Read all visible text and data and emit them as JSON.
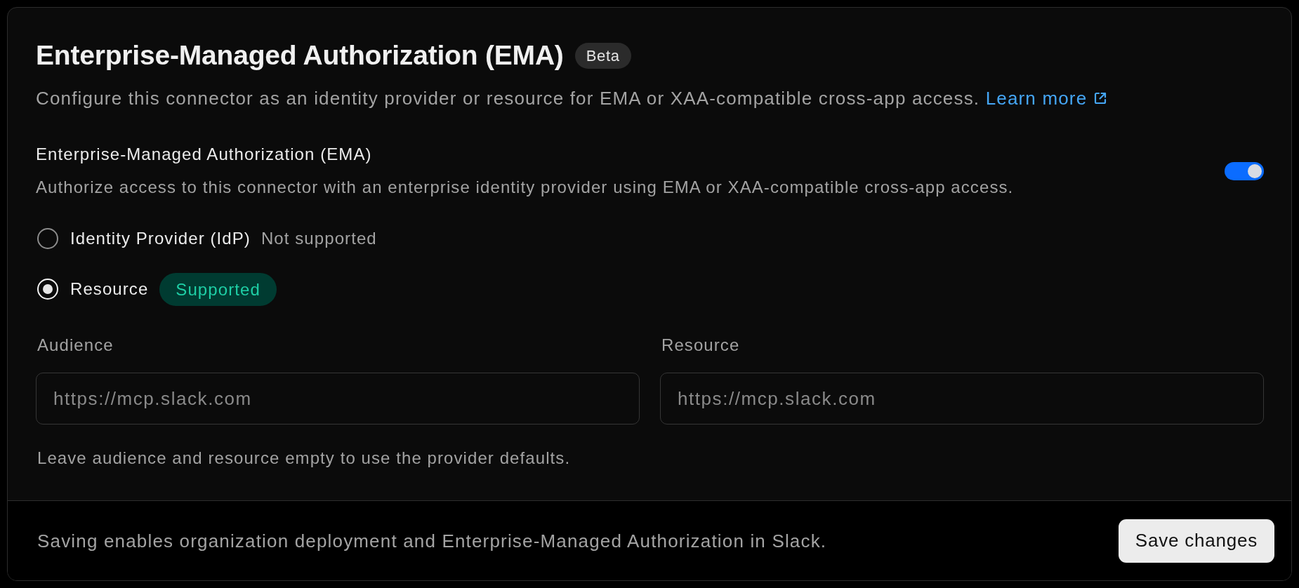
{
  "header": {
    "title": "Enterprise-Managed Authorization (EMA)",
    "badge": "Beta",
    "description": "Configure this connector as an identity provider or resource for EMA or XAA-compatible cross-app access.",
    "link": "Learn more"
  },
  "setting": {
    "label": "Enterprise-Managed Authorization (EMA)",
    "description": "Authorize access to this connector with an enterprise identity provider using EMA or XAA-compatible cross-app access.",
    "on": true
  },
  "options": [
    {
      "label": "Identity Provider (IdP)",
      "selected": false,
      "status": {
        "kind": "note",
        "text": "Not supported"
      }
    },
    {
      "label": "Resource",
      "selected": true,
      "status": {
        "kind": "badge",
        "text": "Supported"
      }
    }
  ],
  "fields": [
    {
      "label": "Audience",
      "placeholder": "https://mcp.slack.com"
    },
    {
      "label": "Resource",
      "placeholder": "https://mcp.slack.com"
    }
  ],
  "help_text": "Leave audience and resource empty to use the provider defaults.",
  "footer": {
    "text": "Saving enables organization deployment and Enterprise-Managed Authorization in Slack.",
    "button": "Save changes"
  }
}
